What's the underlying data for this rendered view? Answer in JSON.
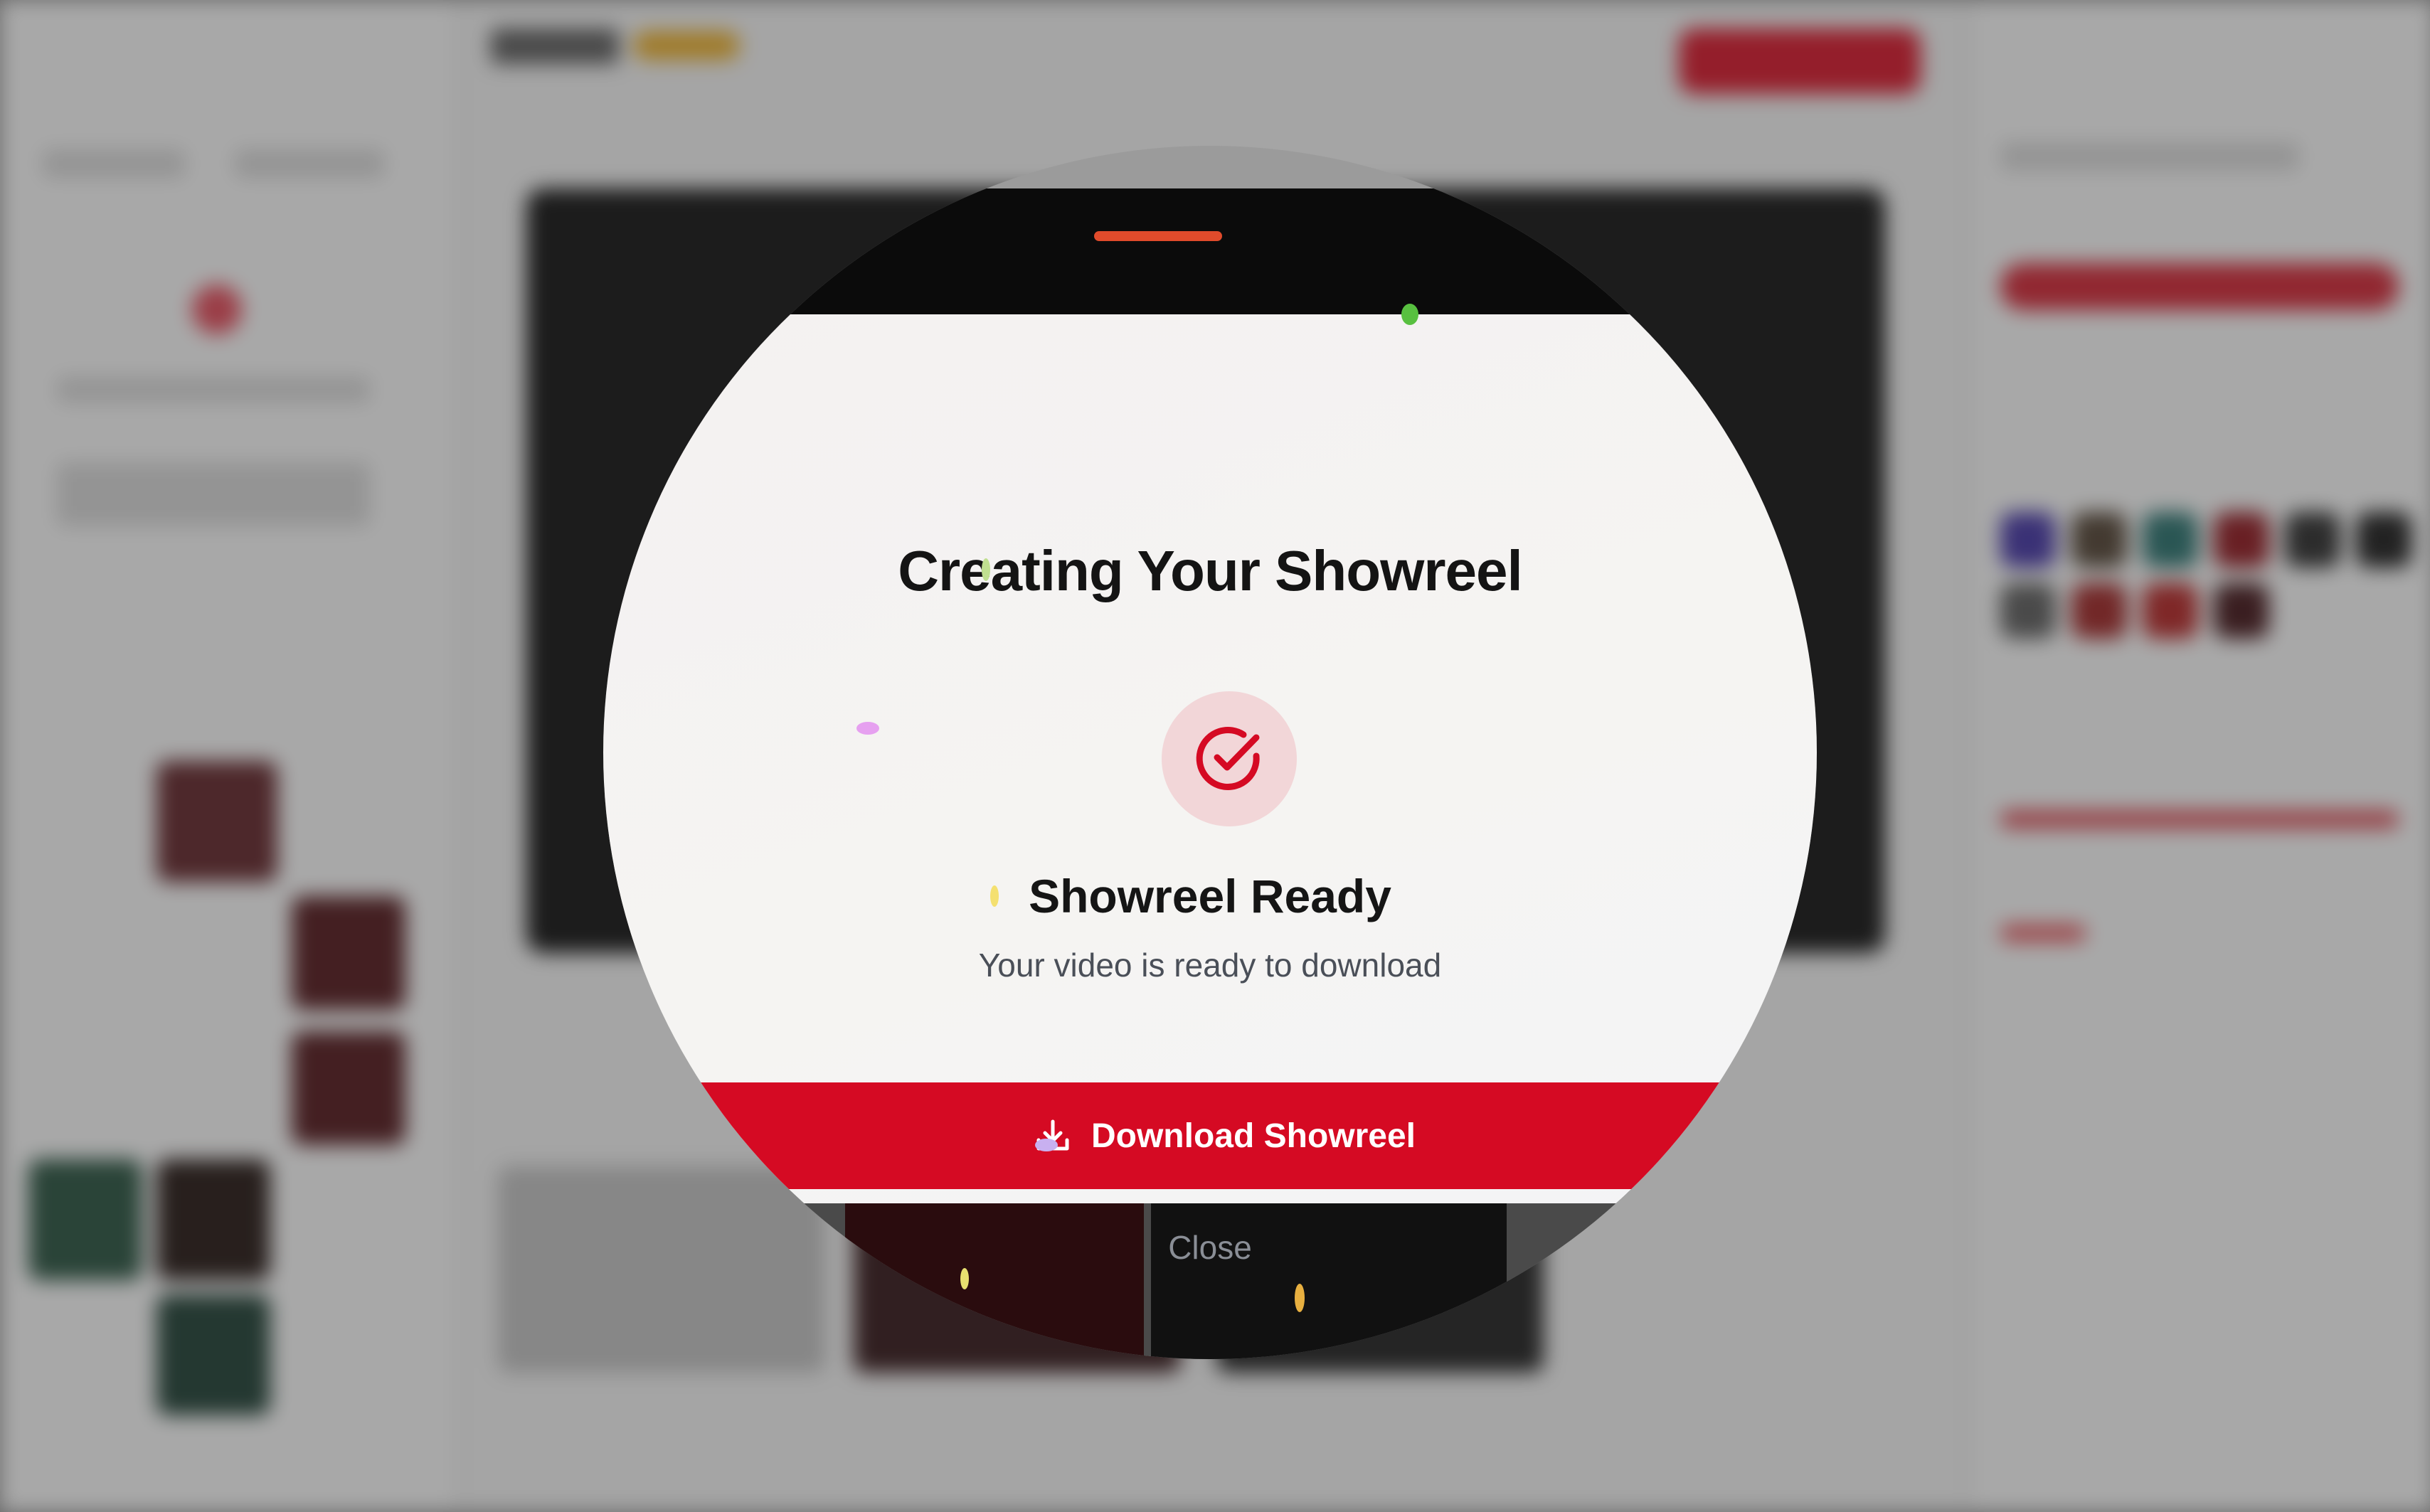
{
  "modal": {
    "title": "Creating Your Showreel",
    "status_title": "Showreel Ready",
    "status_message": "Your video is ready to download",
    "download_label": "Download Showreel",
    "close_label": "Close",
    "success_icon": "check-circle-icon",
    "download_icon": "download-icon"
  },
  "colors": {
    "accent": "#d50a23",
    "icon_bg": "#f2d6d8",
    "title": "#141414",
    "subtitle": "#4a4f58",
    "close_text": "#8a8e96"
  }
}
